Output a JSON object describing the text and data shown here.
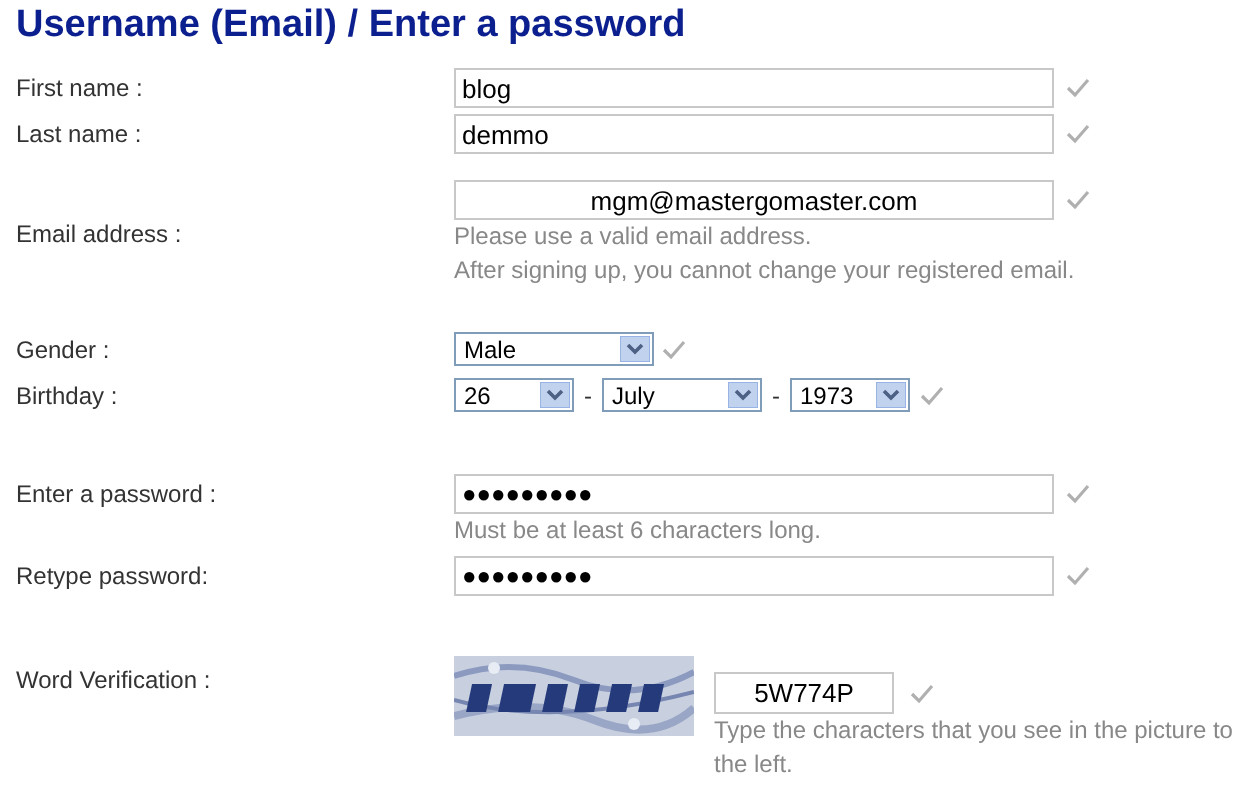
{
  "title": "Username (Email) / Enter a password",
  "fields": [
    {
      "kind": "text",
      "label": "First name :",
      "value": "blog",
      "checked": true
    },
    {
      "kind": "text",
      "label": "Last name :",
      "value": "demmo",
      "checked": true
    },
    {
      "kind": "email",
      "label": "Email address :",
      "value": "mgm@mastergomaster.com",
      "checked": true,
      "hints": [
        "Please use a valid email address.",
        "After signing up, you cannot change your registered email."
      ]
    },
    {
      "kind": "select",
      "label": "Gender :",
      "selects": [
        "Male"
      ],
      "checked": true
    },
    {
      "kind": "date",
      "label": "Birthday :",
      "selects": [
        "26",
        "July",
        "1973"
      ],
      "separator": "-",
      "checked": true
    },
    {
      "kind": "password",
      "label": "Enter a password :",
      "value": "●●●●●●●●●",
      "checked": true,
      "hints": [
        "Must be at least 6 characters long."
      ]
    },
    {
      "kind": "password",
      "label": "Retype password:",
      "value": "●●●●●●●●●",
      "checked": true
    },
    {
      "kind": "captcha",
      "label": "Word Verification :",
      "value": "5W774P",
      "checked": true,
      "hints": [
        "Type the characters that you see in the picture to the left."
      ]
    }
  ]
}
